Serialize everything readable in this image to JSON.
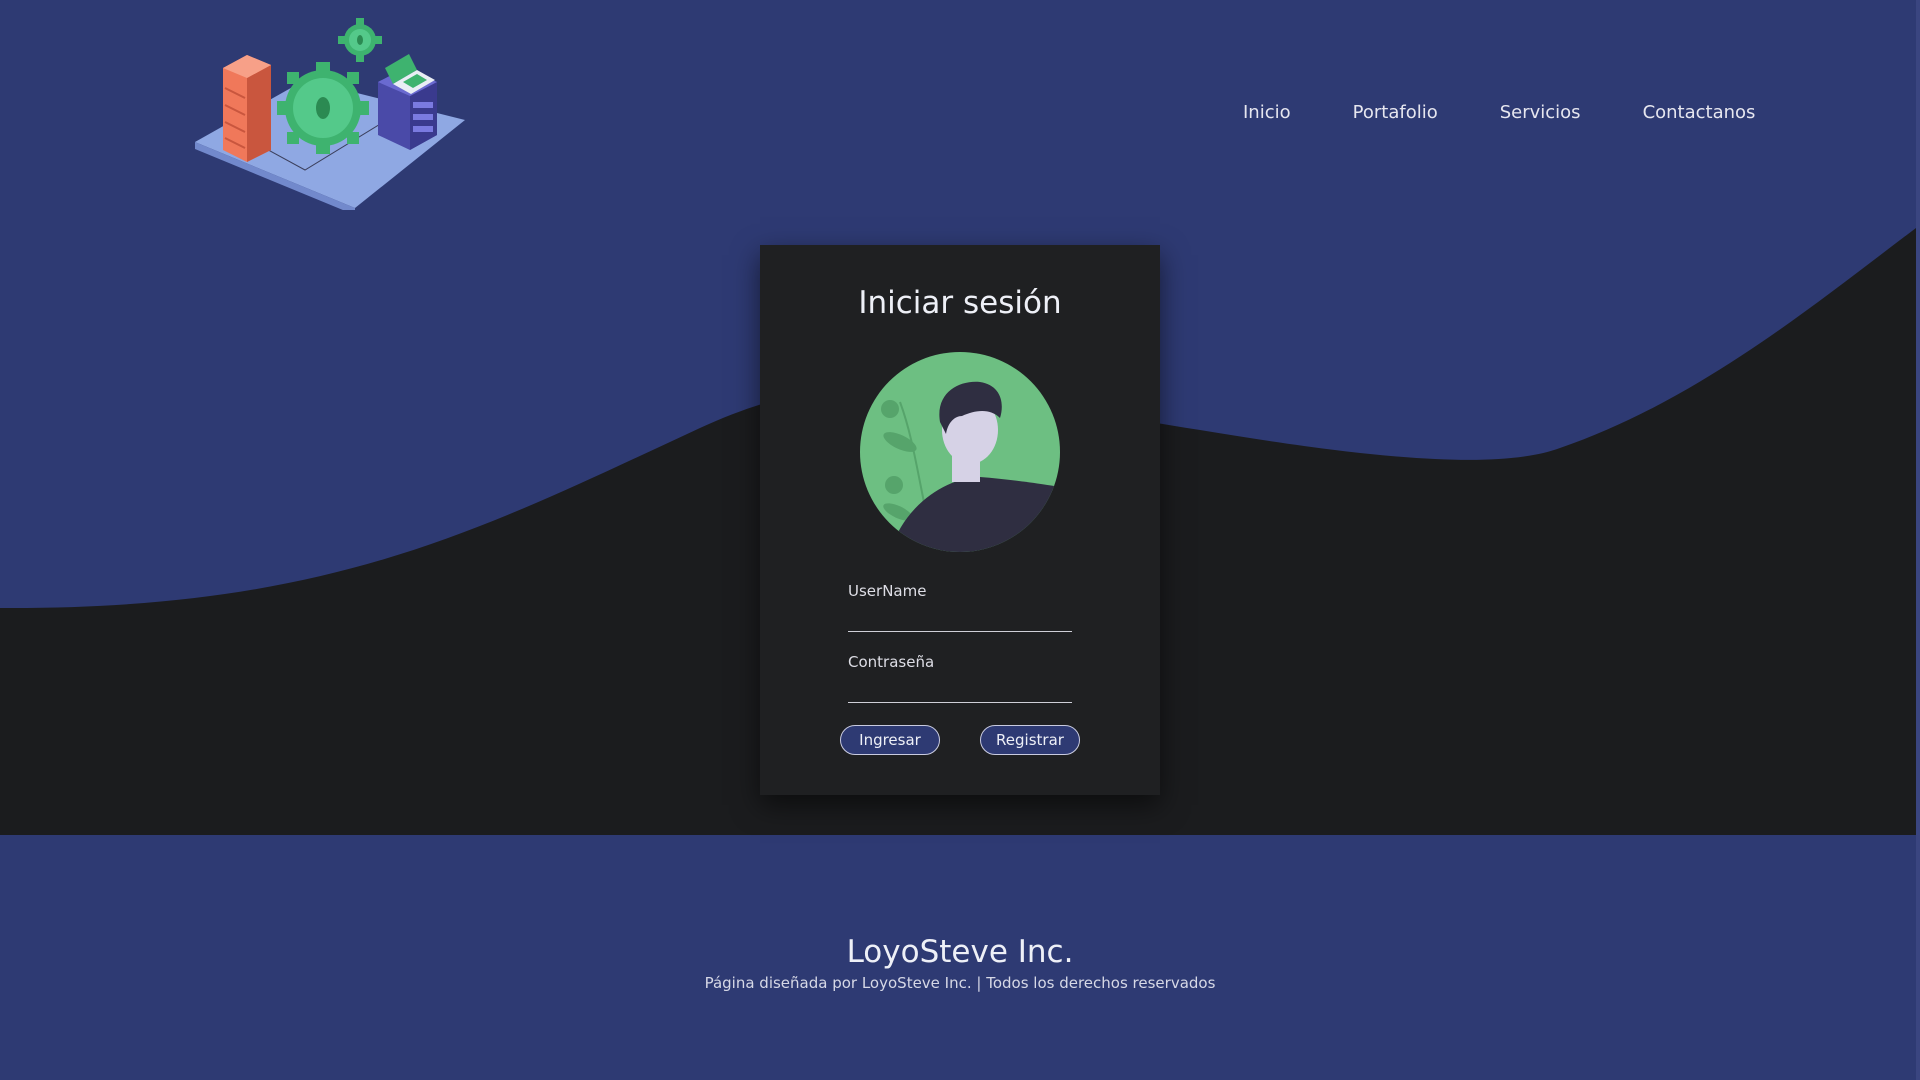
{
  "colors": {
    "page_bg": "#2e3a73",
    "dark_band": "#1b1c1e",
    "card_bg": "#1f2022",
    "accent_green": "#6dbf82",
    "button_bg": "#2e3a73"
  },
  "header": {
    "logo_icon": "isometric-server-gears-illustration",
    "nav": [
      {
        "label": "Inicio"
      },
      {
        "label": "Portafolio"
      },
      {
        "label": "Servicios"
      },
      {
        "label": "Contactanos"
      }
    ]
  },
  "login": {
    "title": "Iniciar sesión",
    "avatar_icon": "user-avatar-illustration",
    "username_label": "UserName",
    "username_value": "",
    "password_label": "Contraseña",
    "password_value": "",
    "submit_label": "Ingresar",
    "register_label": "Registrar"
  },
  "footer": {
    "brand": "LoyoSteve Inc.",
    "note": "Página diseñada por LoyoSteve Inc. | Todos los derechos reservados"
  }
}
